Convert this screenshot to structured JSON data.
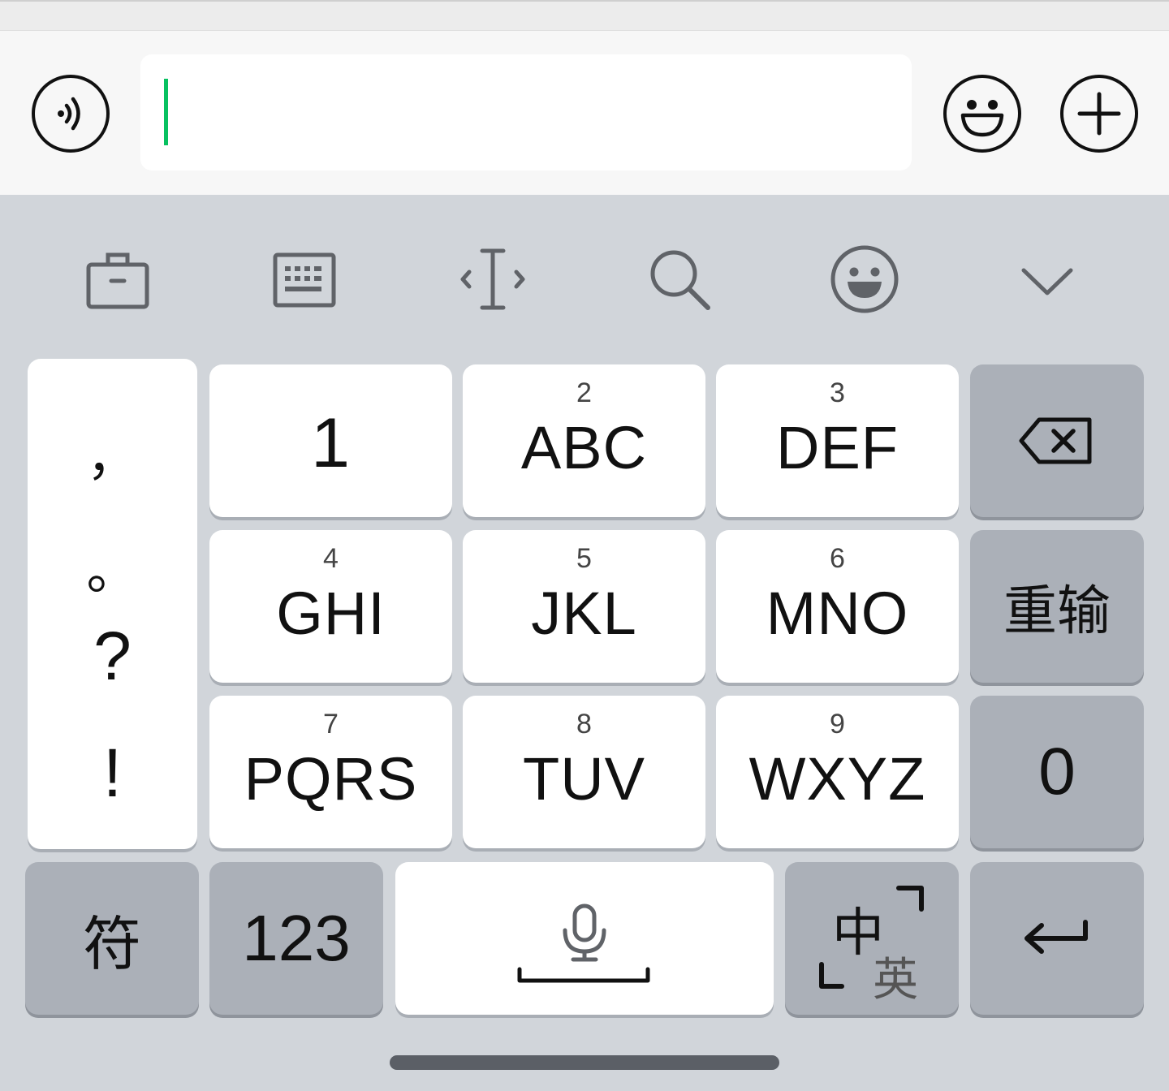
{
  "colors": {
    "caret": "#07c160",
    "key": "#ffffff",
    "function_key": "#abb0b8",
    "keyboard_bg": "#d1d5da"
  },
  "chat_bar": {
    "left_icon": "voice-icon",
    "input_value": "",
    "right_icons": [
      "emoji-icon",
      "plus-icon"
    ]
  },
  "toolbar": {
    "icons": [
      "briefcase-icon",
      "keyboard-icon",
      "cursor-move-icon",
      "search-icon",
      "emoji-icon",
      "chevron-down-icon"
    ]
  },
  "keyboard": {
    "punctuation": [
      "，",
      "。",
      "?",
      "!"
    ],
    "rows": [
      [
        {
          "digit": "",
          "letters": "1"
        },
        {
          "digit": "2",
          "letters": "ABC"
        },
        {
          "digit": "3",
          "letters": "DEF"
        }
      ],
      [
        {
          "digit": "4",
          "letters": "GHI"
        },
        {
          "digit": "5",
          "letters": "JKL"
        },
        {
          "digit": "6",
          "letters": "MNO"
        }
      ],
      [
        {
          "digit": "7",
          "letters": "PQRS"
        },
        {
          "digit": "8",
          "letters": "TUV"
        },
        {
          "digit": "9",
          "letters": "WXYZ"
        }
      ]
    ],
    "backspace_icon": "backspace-icon",
    "retype_label": "重输",
    "zero_label": "0",
    "symbols_label": "符",
    "numbers_label": "123",
    "space_icon": "microphone-icon",
    "lang_zh": "中",
    "lang_en": "英",
    "enter_icon": "enter-icon"
  }
}
